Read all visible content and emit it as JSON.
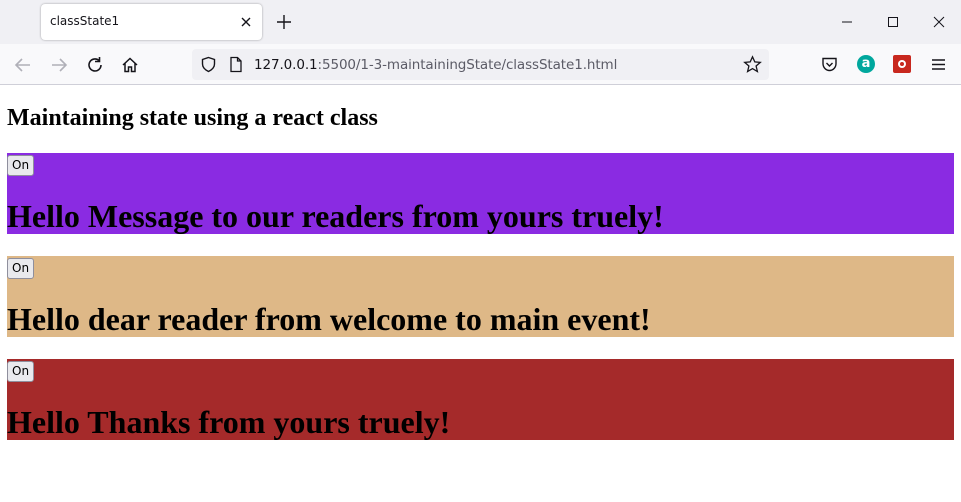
{
  "browser": {
    "tab": {
      "title": "classState1"
    },
    "url": {
      "host": "127.0.0.1",
      "path": ":5500/1-3-maintainingState/classState1.html"
    },
    "extensions": {
      "a_label": "a"
    }
  },
  "page": {
    "title": "Maintaining state using a react class",
    "panels": [
      {
        "button_label": "On",
        "message": "Hello Message to our readers from yours truely!",
        "color": "#8a2be2"
      },
      {
        "button_label": "On",
        "message": "Hello dear reader from welcome to main event!",
        "color": "#deb887"
      },
      {
        "button_label": "On",
        "message": "Hello Thanks from yours truely!",
        "color": "#a52a2a"
      }
    ]
  },
  "icons": [
    "close-icon",
    "plus-icon",
    "minimize-icon",
    "maximize-icon",
    "window-close-icon",
    "back-icon",
    "forward-icon",
    "reload-icon",
    "home-icon",
    "shield-icon",
    "page-icon",
    "bookmark-star-icon",
    "pocket-icon",
    "menu-icon"
  ]
}
